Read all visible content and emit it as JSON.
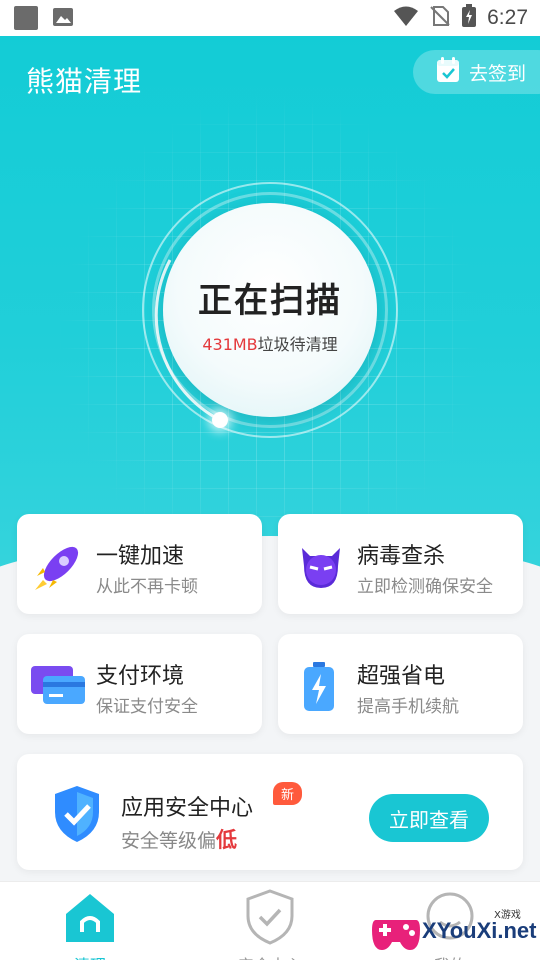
{
  "status_bar": {
    "time": "6:27"
  },
  "header": {
    "app_title": "熊猫清理",
    "signin_label": "去签到"
  },
  "scan": {
    "title": "正在扫描",
    "size": "431MB",
    "size_suffix": "垃圾待清理"
  },
  "features": [
    {
      "title": "一键加速",
      "subtitle": "从此不再卡顿",
      "icon": "rocket-icon"
    },
    {
      "title": "病毒查杀",
      "subtitle": "立即检测确保安全",
      "icon": "virus-icon"
    },
    {
      "title": "支付环境",
      "subtitle": "保证支付安全",
      "icon": "card-icon"
    },
    {
      "title": "超强省电",
      "subtitle": "提高手机续航",
      "icon": "battery-icon"
    }
  ],
  "security": {
    "title": "应用安全中心",
    "badge": "新",
    "subtitle_prefix": "安全等级偏",
    "level": "低",
    "button": "立即查看"
  },
  "nav": [
    {
      "label": "清理",
      "icon": "home-icon",
      "active": true
    },
    {
      "label": "安全中心",
      "icon": "shield-check-icon",
      "active": false
    },
    {
      "label": "我的",
      "icon": "profile-icon",
      "active": false
    }
  ],
  "watermark": {
    "text": "XYouXi.net",
    "small": "X游戏"
  },
  "colors": {
    "accent": "#19c6d3",
    "hero": "#21cfd9",
    "alert": "#e4393c"
  }
}
